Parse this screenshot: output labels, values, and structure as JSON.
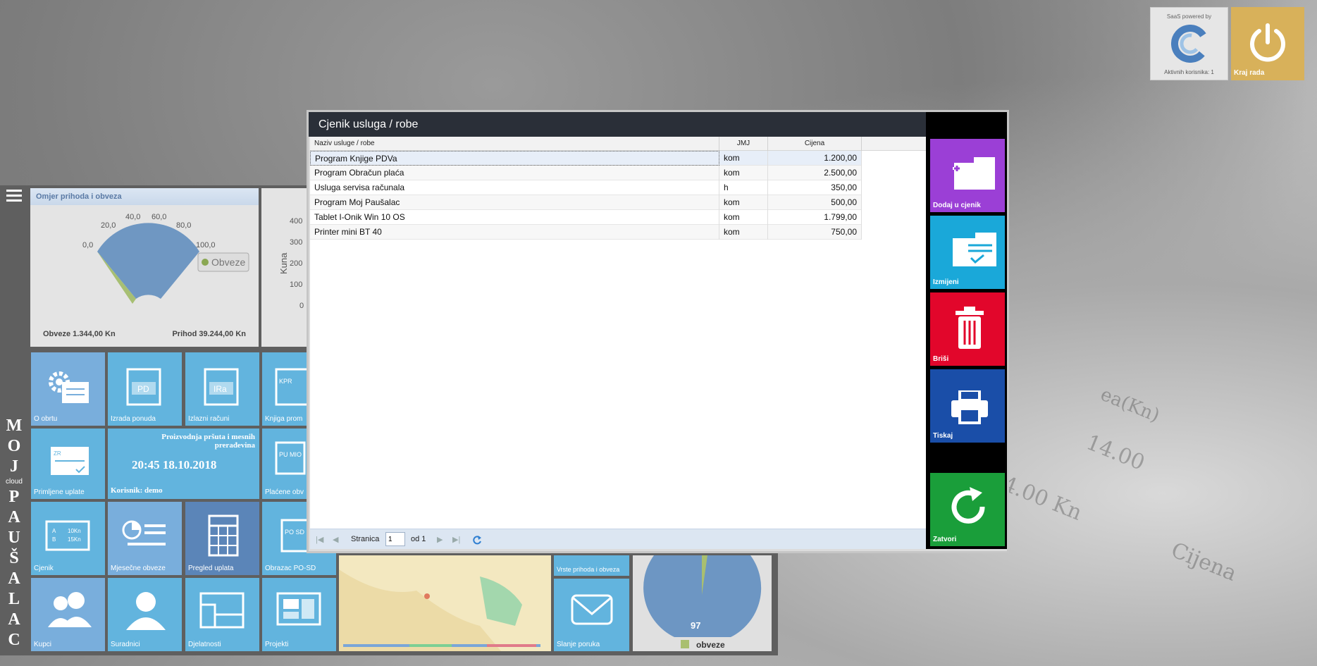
{
  "corner": {
    "saas_caption": "SaaS powered by",
    "active_users": "Aktivnih korisnika: 1",
    "logout_label": "Kraj rada"
  },
  "brand": {
    "line1": [
      "M",
      "O",
      "J"
    ],
    "cloud": "cloud",
    "line2": [
      "P",
      "A",
      "U",
      "Š",
      "A",
      "L",
      "A",
      "C"
    ]
  },
  "gauge_panel": {
    "title": "Omjer prihoda i obveza",
    "ticks": [
      "0,0",
      "20,0",
      "40,0",
      "60,0",
      "80,0",
      "100,0"
    ],
    "legend": "Obveze",
    "obveze": "Obveze 1.344,00 Kn",
    "prihod": "Prihod 39.244,00 Kn"
  },
  "chart2_panel": {
    "ylabel": "Kuna",
    "ticks": [
      "400",
      "300",
      "200",
      "100",
      "0"
    ]
  },
  "tiles": {
    "o_obrtu": "O obrtu",
    "izrada_ponuda": "Izrada ponuda",
    "izlazni_racuni": "Izlazni računi",
    "knjiga_prometa": "Knjiga prom",
    "primljene_uplate": "Primljene uplate",
    "company": "Proizvodnja pršuta i mesnih prerađevina",
    "datetime": "20:45 18.10.2018",
    "user": "Korisnik: demo",
    "placene_obveze": "Plaćene obv",
    "cjenik": "Cjenik",
    "mjesecne_obveze": "Mjesečne obveze",
    "pregled_uplata": "Pregled uplata",
    "obrazac_posd": "Obrazac PO-SD",
    "vrste": "Vrste prihoda i obveza",
    "kupci": "Kupci",
    "suradnici": "Suradnici",
    "djelatnosti": "Djelatnosti",
    "projekti": "Projekti",
    "slanje_poruka": "Slanje poruka",
    "pie_value": "97",
    "pie_legend": "obveze",
    "icon_pd": "PD",
    "icon_ira": "IRa",
    "icon_kpr": "KPR",
    "icon_zr": "ZR",
    "icon_pumic": "PU MIO",
    "icon_posd": "PO SD",
    "icon_a": "A",
    "icon_b": "B",
    "icon_10kn": "10Kn",
    "icon_15kn": "15Kn"
  },
  "dialog": {
    "title": "Cjenik usluga / robe",
    "columns": [
      "Naziv usluge / robe",
      "JMJ",
      "Cijena"
    ],
    "rows": [
      [
        "Program Knjige PDVa",
        "kom",
        "1.200,00"
      ],
      [
        "Program Obračun plaća",
        "kom",
        "2.500,00"
      ],
      [
        "Usluga servisa računala",
        "h",
        "350,00"
      ],
      [
        "Program Moj Paušalac",
        "kom",
        "500,00"
      ],
      [
        "Tablet I-Onik Win 10 OS",
        "kom",
        "1.799,00"
      ],
      [
        "Printer mini BT 40",
        "kom",
        "750,00"
      ]
    ],
    "pager": {
      "page_label": "Stranica",
      "page_value": "1",
      "of_label": "od 1"
    },
    "actions": {
      "add": "Dodaj u cjenik",
      "edit": "Izmijeni",
      "delete": "Briši",
      "print": "Tiskaj",
      "close": "Zatvori"
    }
  },
  "background_text": [
    "14.00",
    "4.00 Kn",
    "Cijena",
    "ea(Kn)"
  ],
  "colors": {
    "add": "#9b3fd6",
    "edit": "#1aa8d9",
    "delete": "#e2062b",
    "print": "#1a4ea8",
    "close": "#1a9e3a",
    "tile_light": "#62b4de",
    "tile_mid": "#79aedc",
    "tile_dark": "#5b85b8",
    "logout": "#d8b15a"
  }
}
